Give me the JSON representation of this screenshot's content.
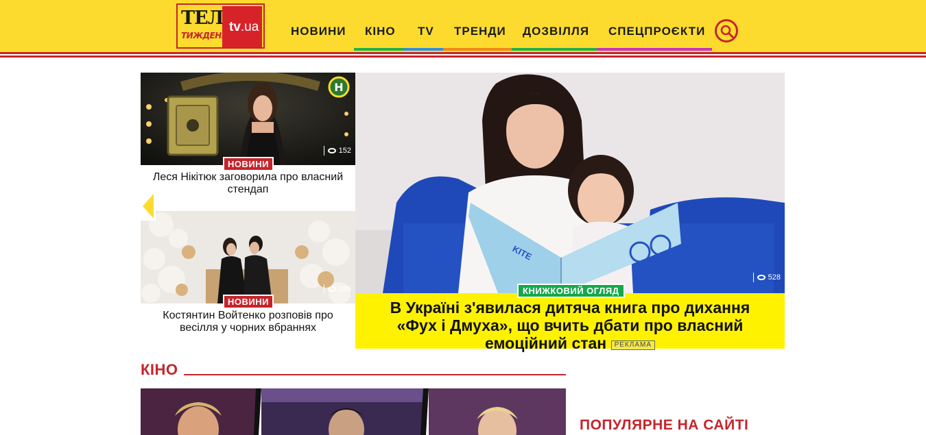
{
  "logo": {
    "line1": "ТЕЛЕ",
    "line2": "ТИЖДЕНЬ",
    "tv": "tv",
    "ua": ".ua"
  },
  "nav": {
    "items": [
      {
        "label": "НОВИНИ",
        "color": ""
      },
      {
        "label": "КІНО",
        "color": "#1fb24a"
      },
      {
        "label": "TV",
        "color": "#2e8fe0"
      },
      {
        "label": "ТРЕНДИ",
        "color": "#f08a1c"
      },
      {
        "label": "ДОЗВІЛЛЯ",
        "color": "#1fb24a"
      },
      {
        "label": "СПЕЦПРОЄКТИ",
        "color": "#c633c6"
      }
    ],
    "search_icon": "search-icon"
  },
  "cards": [
    {
      "badge": "НОВИНИ",
      "title": "Леся Нікітюк заговорила про власний стендап",
      "views": "152",
      "channel_logo": "Н"
    },
    {
      "badge": "НОВИНИ",
      "title": "Костянтин Войтенко розповів про весілля у чорних вбраннях",
      "views": "185"
    }
  ],
  "featured": {
    "badge": "КНИЖКОВИЙ ОГЛЯД",
    "title": "В Україні з'явилася дитяча книга про дихання «Фух і Дмуха», що вчить дбати про власний емоційний стан",
    "ad_label": "РЕКЛАМА",
    "views": "528",
    "book_label": "KITE"
  },
  "sections": {
    "kino_title": "КІНО",
    "popular_title": "ПОПУЛЯРНЕ НА САЙТІ"
  },
  "colors": {
    "header_bg": "#fddb2e",
    "accent_red": "#c6242b",
    "featured_caption_bg": "#fff200",
    "badge_green": "#14a84b"
  }
}
